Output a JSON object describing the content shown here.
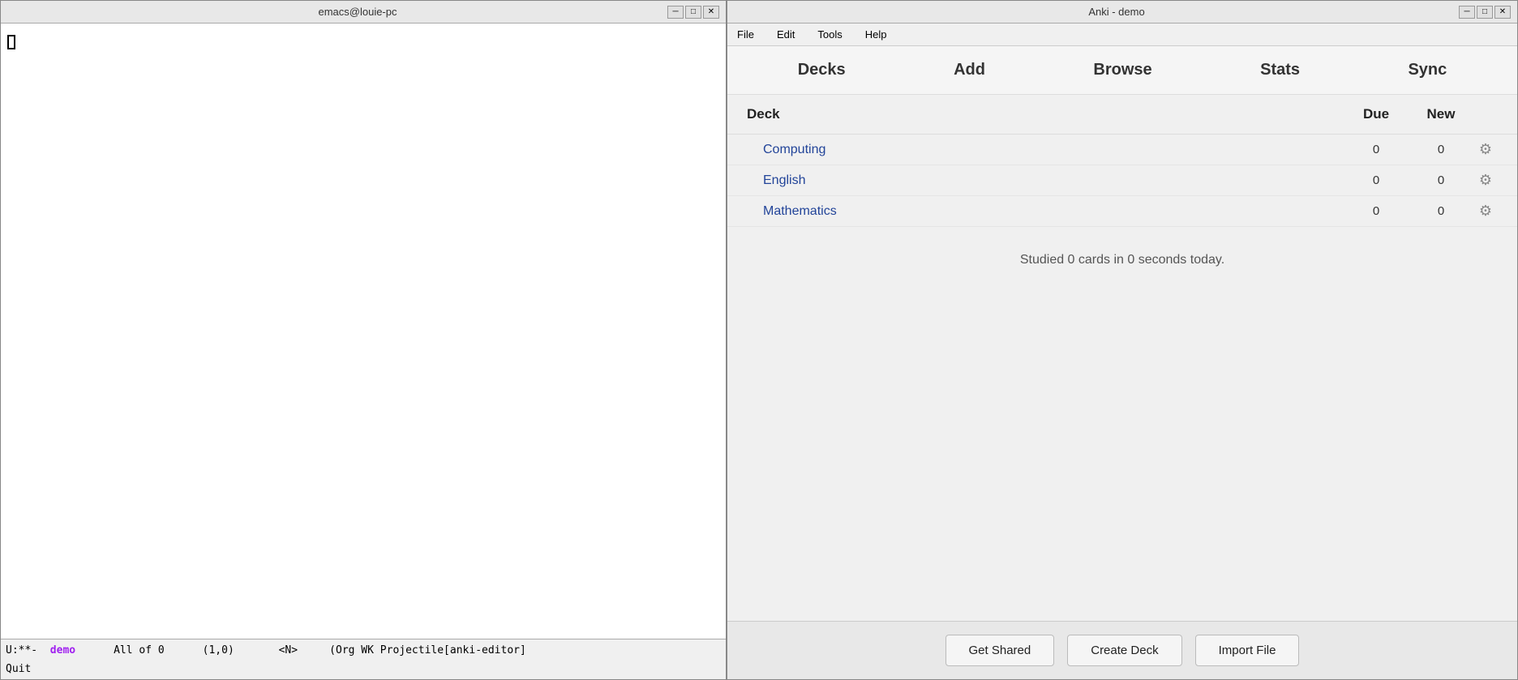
{
  "emacs": {
    "title": "emacs@louie-pc",
    "status_left": "U:**-  ",
    "status_demo": "demo",
    "status_mid": "      All of 0      (1,0)       <N>     (Org WK Projectile[anki-editor]",
    "minibuffer": "Quit",
    "win_minimize": "─",
    "win_restore": "□",
    "win_close": "✕"
  },
  "anki": {
    "title": "Anki - demo",
    "menu": {
      "file": "File",
      "edit": "Edit",
      "tools": "Tools",
      "help": "Help"
    },
    "toolbar": {
      "decks": "Decks",
      "add": "Add",
      "browse": "Browse",
      "stats": "Stats",
      "sync": "Sync"
    },
    "deck_list": {
      "col_deck": "Deck",
      "col_due": "Due",
      "col_new": "New",
      "decks": [
        {
          "name": "Computing",
          "due": 0,
          "new": 0
        },
        {
          "name": "English",
          "due": 0,
          "new": 0
        },
        {
          "name": "Mathematics",
          "due": 0,
          "new": 0
        }
      ]
    },
    "studied_text": "Studied 0 cards in 0 seconds today.",
    "footer": {
      "get_shared": "Get Shared",
      "create_deck": "Create Deck",
      "import_file": "Import File"
    }
  }
}
